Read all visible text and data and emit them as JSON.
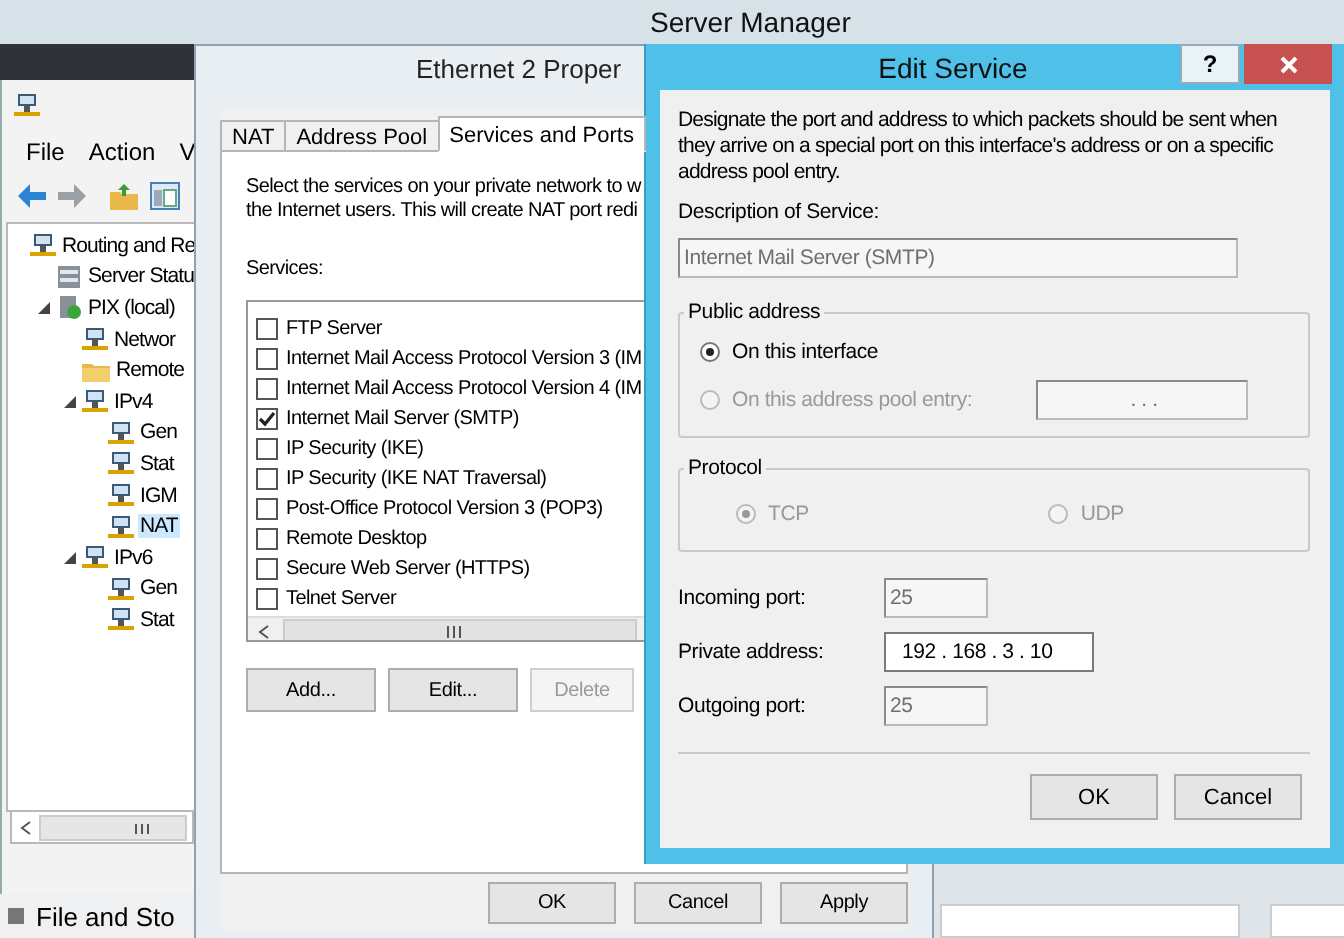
{
  "desktop": {
    "title": "Server Manager",
    "bottom_label": "File and Sto"
  },
  "mmc": {
    "menu": [
      "File",
      "Action",
      "V"
    ],
    "tree": [
      {
        "label": "Routing and Re",
        "kind": "node",
        "selected": false,
        "children": [
          {
            "label": "Server Statu",
            "kind": "status",
            "selected": false
          },
          {
            "label": "PIX (local)",
            "kind": "server",
            "selected": false,
            "expanded": true,
            "children": [
              {
                "label": "Networ",
                "kind": "node",
                "selected": false
              },
              {
                "label": "Remote",
                "kind": "folder",
                "selected": false
              },
              {
                "label": "IPv4",
                "kind": "node",
                "selected": false,
                "expanded": true,
                "children": [
                  {
                    "label": "Gen",
                    "kind": "node",
                    "selected": false
                  },
                  {
                    "label": "Stat",
                    "kind": "node",
                    "selected": false
                  },
                  {
                    "label": "IGM",
                    "kind": "node",
                    "selected": false
                  },
                  {
                    "label": "NAT",
                    "kind": "node",
                    "selected": true
                  }
                ]
              },
              {
                "label": "IPv6",
                "kind": "node",
                "selected": false,
                "expanded": true,
                "children": [
                  {
                    "label": "Gen",
                    "kind": "node",
                    "selected": false
                  },
                  {
                    "label": "Stat",
                    "kind": "node",
                    "selected": false
                  }
                ]
              }
            ]
          }
        ]
      }
    ]
  },
  "properties_window": {
    "title": "Ethernet 2 Proper",
    "tabs": [
      {
        "label": "NAT",
        "selected": false
      },
      {
        "label": "Address Pool",
        "selected": false
      },
      {
        "label": "Services and Ports",
        "selected": true
      }
    ],
    "intro_lines": [
      "Select the services on your private network to w",
      "the Internet users. This will create NAT port redi"
    ],
    "services_label": "Services:",
    "services": [
      {
        "label": "FTP Server",
        "checked": false
      },
      {
        "label": "Internet Mail Access Protocol Version 3 (IM",
        "checked": false
      },
      {
        "label": "Internet Mail Access Protocol Version 4 (IM",
        "checked": false
      },
      {
        "label": "Internet Mail Server (SMTP)",
        "checked": true
      },
      {
        "label": "IP Security (IKE)",
        "checked": false
      },
      {
        "label": "IP Security (IKE NAT Traversal)",
        "checked": false
      },
      {
        "label": "Post-Office Protocol Version 3 (POP3)",
        "checked": false
      },
      {
        "label": "Remote Desktop",
        "checked": false
      },
      {
        "label": "Secure Web Server (HTTPS)",
        "checked": false
      },
      {
        "label": "Telnet Server",
        "checked": false
      }
    ],
    "buttons": [
      {
        "label": "Add...",
        "disabled": false
      },
      {
        "label": "Edit...",
        "disabled": false
      },
      {
        "label": "Delete",
        "disabled": true
      }
    ],
    "footer_buttons": [
      "OK",
      "Cancel",
      "Apply"
    ]
  },
  "edit_service": {
    "title": "Edit Service",
    "help": "?",
    "intro": "Designate the port and address to which packets should be sent when they arrive on a special port on this interface's address or on a specific address pool entry.",
    "description_label": "Description of Service:",
    "description_value": "Internet Mail Server (SMTP)",
    "public_address": {
      "legend": "Public address",
      "options": [
        {
          "label": "On this interface",
          "selected": true,
          "disabled": false
        },
        {
          "label": "On this address pool entry:",
          "selected": false,
          "disabled": true
        }
      ],
      "pool_entry_value": ".      .      ."
    },
    "protocol": {
      "legend": "Protocol",
      "options": [
        {
          "label": "TCP",
          "selected": true,
          "disabled": true
        },
        {
          "label": "UDP",
          "selected": false,
          "disabled": true
        }
      ]
    },
    "fields": [
      {
        "label": "Incoming port:",
        "value": "25",
        "disabled": true,
        "kind": "port"
      },
      {
        "label": "Private address:",
        "value": "192 . 168 .  3  . 10",
        "disabled": false,
        "kind": "address"
      },
      {
        "label": "Outgoing port:",
        "value": "25",
        "disabled": true,
        "kind": "port"
      }
    ],
    "buttons": [
      "OK",
      "Cancel"
    ]
  }
}
